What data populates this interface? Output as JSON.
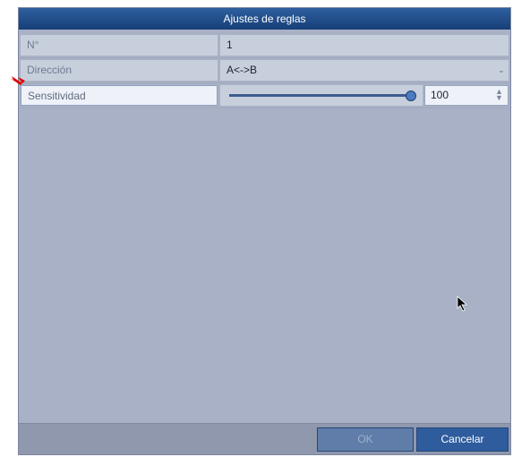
{
  "dialog": {
    "title": "Ajustes de reglas",
    "rows": [
      {
        "label": "N°",
        "value": "1"
      },
      {
        "label": "Dirección",
        "value": "A<->B"
      },
      {
        "label": "Sensitividad",
        "value": "100"
      }
    ],
    "slider": {
      "level": 100,
      "max": 100
    },
    "buttons": {
      "ok": "OK",
      "cancel": "Cancelar"
    }
  },
  "colors": {
    "title_bar": "#1f4b8a",
    "panel": "#a9b1c6",
    "field": "#c8cfdc",
    "cancel_button": "#2e5c9d",
    "arrow": "#e00000"
  },
  "icons": {
    "dropdown": "chevron-down-icon",
    "spinner": "spinner-icon",
    "cursor": "mouse-pointer-icon",
    "annotation": "red-arrow-icon"
  }
}
